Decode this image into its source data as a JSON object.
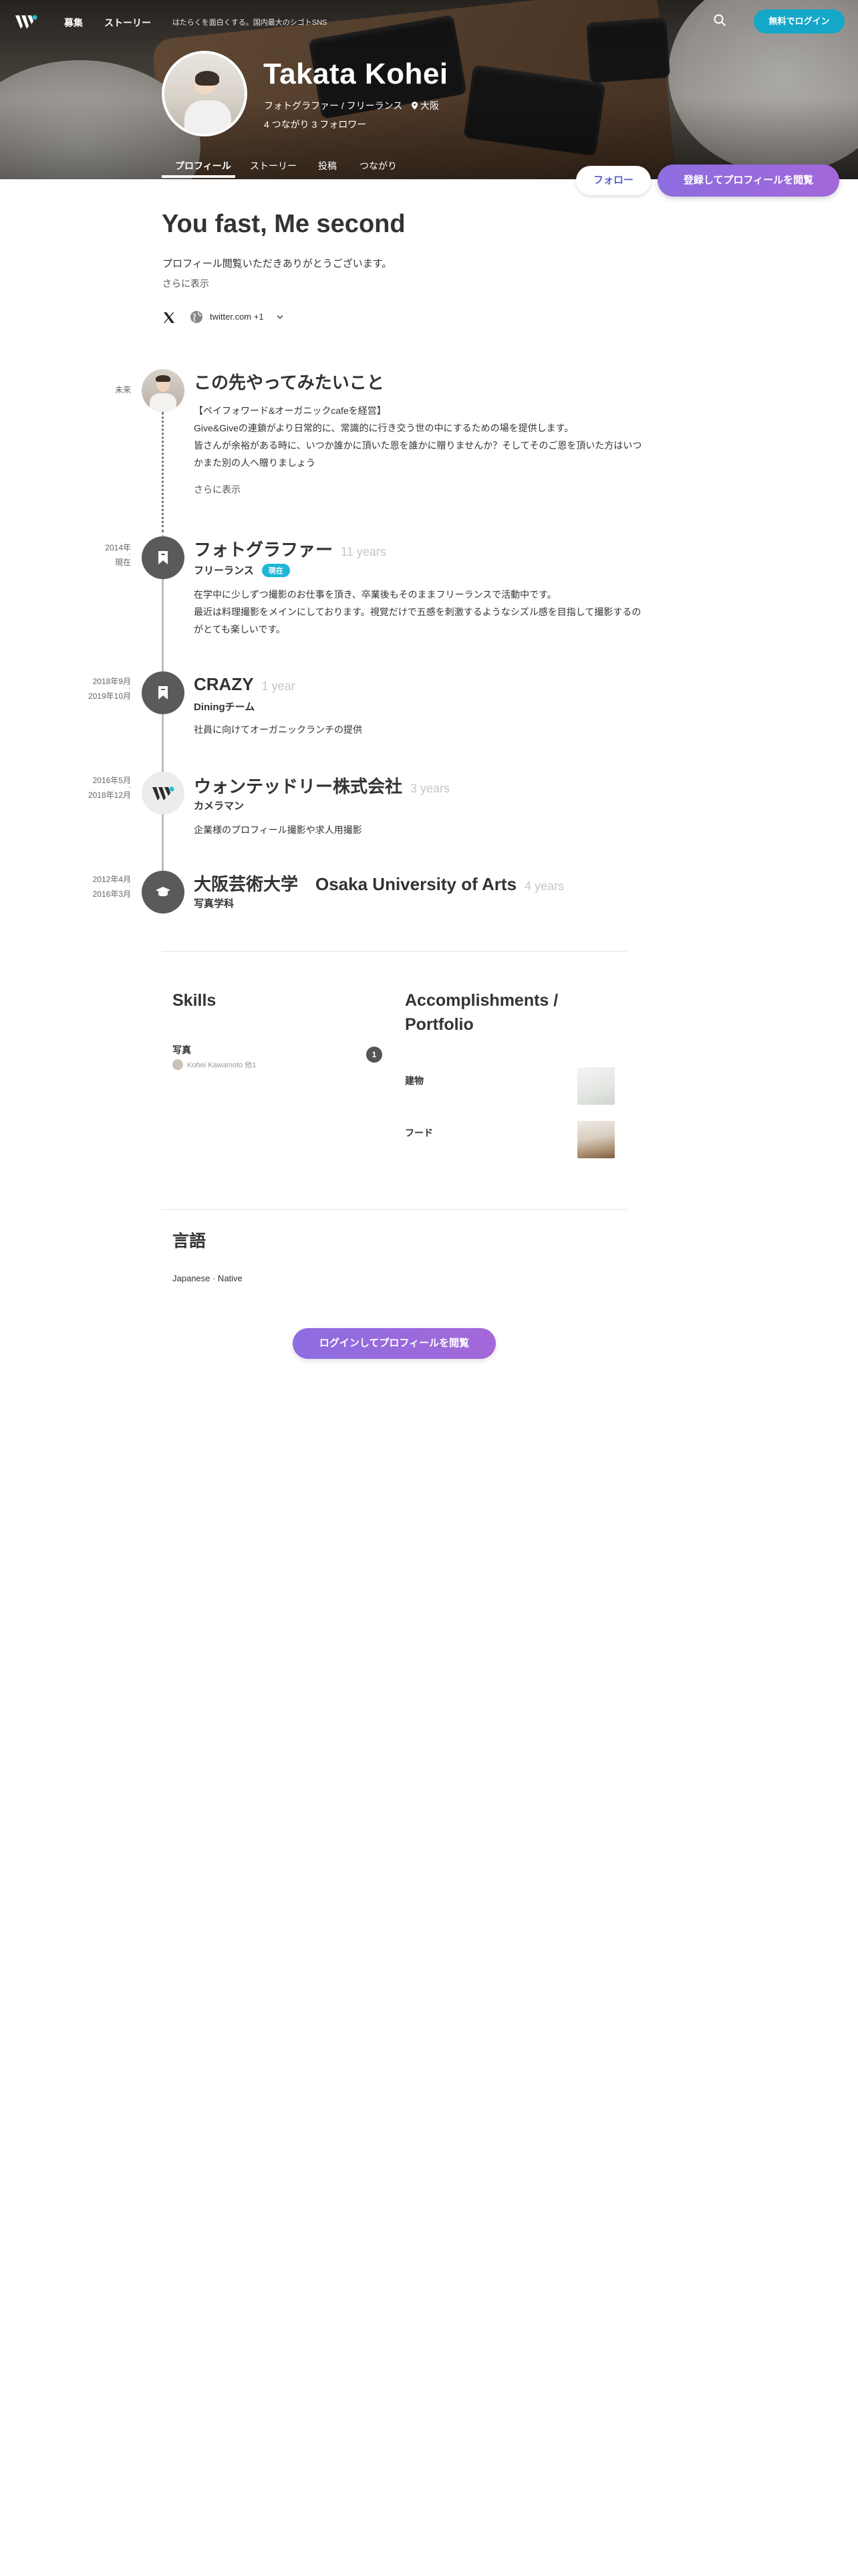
{
  "nav": {
    "links": [
      "募集",
      "ストーリー"
    ],
    "tagline": "はたらくを面白くする。国内最大のシゴトSNS",
    "login_label": "無料でログイン"
  },
  "profile": {
    "name": "Takata Kohei",
    "role": "フォトグラファー / フリーランス",
    "location": "大阪",
    "connections": "4 つながり 3 フォロワー",
    "tabs": [
      "プロフィール",
      "ストーリー",
      "投稿",
      "つながり"
    ],
    "follow_label": "フォロー",
    "register_label": "登録してプロフィールを閲覧"
  },
  "headline": "You fast, Me second",
  "intro": "プロフィール閲覧いただきありがとうございます。",
  "show_more": "さらに表示",
  "links": {
    "twitter": "twitter.com +1"
  },
  "timeline": [
    {
      "date_from": "未来",
      "date_to": "",
      "title": "この先やってみたいこと",
      "lines": [
        "【ペイフォワード&オーガニックcafeを経営】",
        "Give&Giveの連鎖がより日常的に、常識的に行き交う世の中にするための場を提供します。",
        "皆さんが余裕がある時に、いつか誰かに頂いた恩を誰かに贈りませんか？そしてそのご恩を頂いた方はいつかまた別の人へ贈りましょう"
      ],
      "more": "さらに表示"
    },
    {
      "date_from": "2014年",
      "date_to": "現在",
      "title": "フォトグラファー",
      "duration": "11 years",
      "sub": "フリーランス",
      "badge": "現在",
      "lines": [
        "在学中に少しずつ撮影のお仕事を頂き、卒業後もそのままフリーランスで活動中です。",
        "最近は料理撮影をメインにしております。視覚だけで五感を刺激するようなシズル感を目指して撮影するのがとても楽しいです。"
      ]
    },
    {
      "date_from": "2018年9月",
      "date_to": "2019年10月",
      "title": "CRAZY",
      "duration": "1 year",
      "sub": "Diningチーム",
      "lines": [
        "社員に向けてオーガニックランチの提供"
      ]
    },
    {
      "date_from": "2016年5月",
      "date_to": "2018年12月",
      "title": "ウォンテッドリー株式会社",
      "duration": "3 years",
      "sub": "カメラマン",
      "lines": [
        "企業様のプロフィール撮影や求人用撮影"
      ]
    },
    {
      "date_from": "2012年4月",
      "date_to": "2016年3月",
      "title": "大阪芸術大学　Osaka University of Arts",
      "duration": "4 years",
      "sub": "写真学科"
    }
  ],
  "skills": {
    "title": "Skills",
    "items": [
      {
        "name": "写真",
        "endorsement": "Kohei Kawamoto 他1",
        "count": "1"
      }
    ]
  },
  "portfolio": {
    "title_line1": "Accomplishments /",
    "title_line2": "Portfolio",
    "items": [
      "建物",
      "フード"
    ]
  },
  "languages": {
    "title": "言語",
    "line": "Japanese · Native"
  },
  "bottom_cta": "ログインしてプロフィールを閲覧",
  "colors": {
    "accent_teal": "#14a7c8",
    "cta_purple": "#8d6de0",
    "badge_cyan": "#1fb6d8"
  }
}
